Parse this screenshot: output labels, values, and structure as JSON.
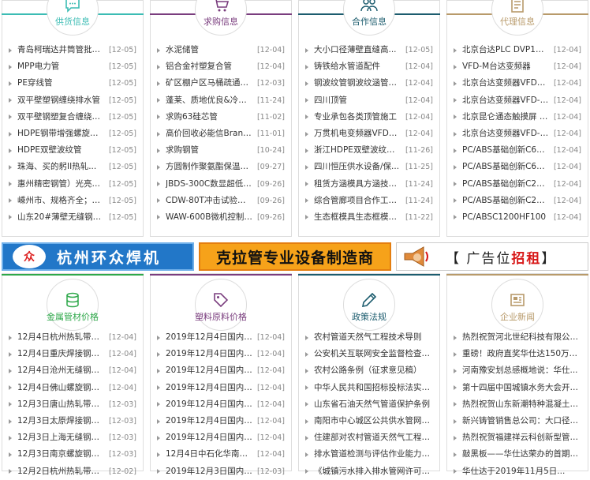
{
  "panels_top": [
    {
      "title": "供货信息",
      "color": "#3cbcb4",
      "icon": "chat-icon",
      "items": [
        [
          "青岛柯瑞达井筒管批发...",
          "[12-05]"
        ],
        [
          "MPP电力管",
          "[12-05]"
        ],
        [
          "PE穿线管",
          "[12-05]"
        ],
        [
          "双平壁塑钢缠绕排水管",
          "[12-05]"
        ],
        [
          "双平壁钢塑复合缠绕排...",
          "[12-05]"
        ],
        [
          "HDPE钢带增强螺旋波纹...",
          "[12-05]"
        ],
        [
          "HDPE双壁波纹管",
          "[12-05]"
        ],
        [
          "珠海、买的躬II热轧...",
          "[12-05]"
        ],
        [
          "惠州精密钢管）光亮管...",
          "[12-05]"
        ],
        [
          "嵊州市、规格齐全；20...",
          "[12-05]"
        ],
        [
          "山东20#薄壁无缝钢管...",
          "[12-05]"
        ]
      ]
    },
    {
      "title": "求购信息",
      "color": "#7a3d7e",
      "icon": "cart-icon",
      "items": [
        [
          "水泥储管",
          "[12-04]"
        ],
        [
          "铝合金衬塑复合管",
          "[12-04]"
        ],
        [
          "矿区棚户区马桶疏通兼...",
          "[12-03]"
        ],
        [
          "蓬莱、质地优良&冷拔...",
          "[11-24]"
        ],
        [
          "求购63硅芯管",
          "[11-02]"
        ],
        [
          "高价回收必能信Branso...",
          "[11-01]"
        ],
        [
          "求购钢管",
          "[10-24]"
        ],
        [
          "方圆制作聚氨酯保温钢...",
          "[09-27]"
        ],
        [
          "JBDS-300C数显超低温...",
          "[09-26]"
        ],
        [
          "CDW-80T冲击试验低温...",
          "[09-26]"
        ],
        [
          "WAW-600B微机控制电液...",
          "[09-26]"
        ]
      ]
    },
    {
      "title": "合作信息",
      "color": "#1c5c6e",
      "icon": "people-icon",
      "items": [
        [
          "大小口径薄壁直缝高...",
          "[12-05]"
        ],
        [
          "铸铁给水管道配件",
          "[12-04]"
        ],
        [
          "钢波纹管钢波纹涵管金...",
          "[12-04]"
        ],
        [
          "四川顶管",
          "[12-04]"
        ],
        [
          "专业承包各类顶管施工",
          "[12-04]"
        ],
        [
          "万贯机电变频器VFD0...",
          "[12-04]"
        ],
        [
          "浙江HDPE双壁波纹管生...",
          "[11-26]"
        ],
        [
          "四川恒压供水设备/保...",
          "[11-25]"
        ],
        [
          "租赁方涵模具方涵技术...",
          "[11-24]"
        ],
        [
          "综合管廊项目合作工程...",
          "[11-24]"
        ],
        [
          "生态框模具生态框模具...",
          "[11-22]"
        ]
      ]
    },
    {
      "title": "代理信息",
      "color": "#b89a6a",
      "icon": "document-icon",
      "items": [
        [
          "北京台达PLC DVP14SS2...",
          "[12-04]"
        ],
        [
          "VFD-M台达变频器",
          "[12-04]"
        ],
        [
          "北京台达变频器VFD015...",
          "[12-04]"
        ],
        [
          "北京台达变频器VFD-CP...",
          "[12-04]"
        ],
        [
          "北京昆仑通态触摸屏 T...",
          "[12-04]"
        ],
        [
          "北京台达变频器VFD-M...",
          "[12-04]"
        ],
        [
          "PC/ABS基础创新C66001...",
          "[12-04]"
        ],
        [
          "PC/ABS基础创新C62001...",
          "[12-04]"
        ],
        [
          "PC/ABS基础创新C29501...",
          "[12-04]"
        ],
        [
          "PC/ABS基础创新C28001...",
          "[12-04]"
        ],
        [
          "PC/ABSC1200HF100",
          "[12-04]"
        ]
      ]
    }
  ],
  "ads": {
    "ad1_logo": "众",
    "ad1_text": "杭州环众焊机",
    "ad2_text": "克拉管专业设备制造商",
    "ad3_prefix": "【 广告位",
    "ad3_hi1": "招",
    "ad3_hi2": "租",
    "ad3_suffix": "】"
  },
  "panels_bottom": [
    {
      "title": "金属管材价格",
      "color": "#2ea84a",
      "icon": "database-icon",
      "items": [
        [
          "12月4日杭州热轧带钢...",
          "[12-04]"
        ],
        [
          "12月4日重庆焊接钢管...",
          "[12-04]"
        ],
        [
          "12月4日沧州无缝钢管...",
          "[12-04]"
        ],
        [
          "12月4日佛山螺旋钢管...",
          "[12-04]"
        ],
        [
          "12月3日唐山热轧带钢...",
          "[12-03]"
        ],
        [
          "12月3日太原焊接钢管...",
          "[12-03]"
        ],
        [
          "12月3日上海无缝钢管...",
          "[12-03]"
        ],
        [
          "12月3日南京螺旋钢管...",
          "[12-03]"
        ],
        [
          "12月2日杭州热轧带钢...",
          "[12-02]"
        ]
      ]
    },
    {
      "title": "塑料原料价格",
      "color": "#7a3d7e",
      "icon": "price-tag-icon",
      "items": [
        [
          "2019年12月4日国内塑...",
          "[12-04]"
        ],
        [
          "2019年12月4日国内塑...",
          "[12-04]"
        ],
        [
          "2019年12月4日国内塑...",
          "[12-04]"
        ],
        [
          "2019年12月4日国内塑...",
          "[12-04]"
        ],
        [
          "2019年12月4日国内塑...",
          "[12-04]"
        ],
        [
          "2019年12月4日国内塑...",
          "[12-04]"
        ],
        [
          "2019年12月4日国内塑...",
          "[12-04]"
        ],
        [
          "12月4日中石化华南PP...",
          "[12-04]"
        ],
        [
          "2019年12月3日国内塑...",
          "[12-03]"
        ]
      ]
    },
    {
      "title": "政策法规",
      "color": "#1c5c6e",
      "icon": "pen-icon",
      "items": [
        [
          "农村管道天然气工程技术导则",
          ""
        ],
        [
          "公安机关互联网安全监督检查规...",
          ""
        ],
        [
          "农村公路条例（征求意见稿）",
          ""
        ],
        [
          "中华人民共和国招标投标法实施...",
          ""
        ],
        [
          "山东省石油天然气管道保护条例",
          ""
        ],
        [
          "南阳市中心城区公共供水管网覆...",
          ""
        ],
        [
          "住建部对农村管道天然气工程技...",
          ""
        ],
        [
          "排水管道检测与评估作业能力评...",
          ""
        ],
        [
          "《城镇污水排入排水管网许可管...",
          ""
        ]
      ]
    },
    {
      "title": "企业新闻",
      "color": "#b89a6a",
      "icon": "newspaper-icon",
      "items": [
        [
          "热烈祝贺河北世纪科技有限公司...",
          ""
        ],
        [
          "重磅！政府直奖华仕达150万元...",
          ""
        ],
        [
          "河南豫安划总感概地说：华仕...",
          ""
        ],
        [
          "第十四届中国城镇水务大会开幕...",
          ""
        ],
        [
          "热烈祝贺山东新潮特种混凝土构...",
          ""
        ],
        [
          "新兴铸管销售总公司：大口径球...",
          ""
        ],
        [
          "热烈祝贺福建祥云科创新型管业...",
          ""
        ],
        [
          "敲黑板——华仕达荣办的首期专...",
          ""
        ],
        [
          "华仕达于2019年11月5日...",
          ""
        ]
      ]
    }
  ]
}
